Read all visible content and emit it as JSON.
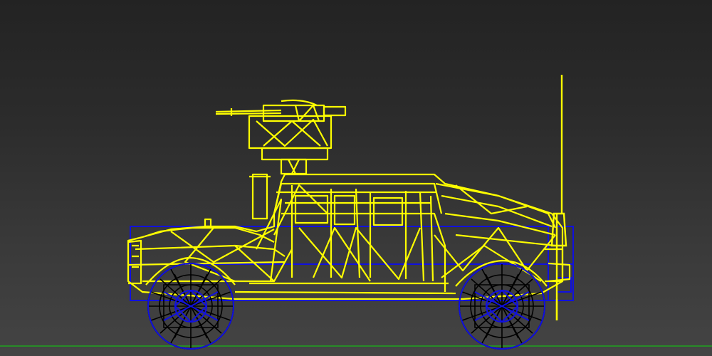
{
  "viewport": {
    "background_top": "#232323",
    "background_bottom": "#444444",
    "grid_line_color": "#1fa31f"
  },
  "model": {
    "wireframe_color": "#ffff00",
    "wheel_wire_color": "#000000",
    "bounding_box_color": "#1010e0",
    "parts": [
      "humvee-body",
      "turret-gun",
      "antenna",
      "front-wheel",
      "rear-wheel",
      "bounding-box"
    ]
  }
}
